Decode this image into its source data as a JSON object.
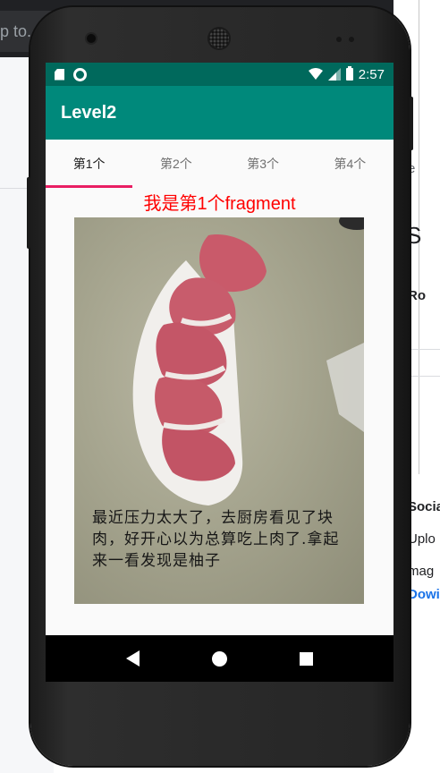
{
  "background": {
    "left_input_text": "p to.",
    "right_texts": [
      "e",
      "S",
      "Ro",
      "Socia",
      "Uplo",
      "mag",
      "Dowi"
    ]
  },
  "status_bar": {
    "time": "2:57",
    "icons": [
      "sd-card-icon",
      "sync-ring-icon",
      "wifi-icon",
      "signal-icon",
      "battery-icon"
    ]
  },
  "app_bar": {
    "title": "Level2"
  },
  "tabs": [
    {
      "label": "第1个",
      "active": true
    },
    {
      "label": "第2个",
      "active": false
    },
    {
      "label": "第3个",
      "active": false
    },
    {
      "label": "第4个",
      "active": false
    }
  ],
  "fragment": {
    "text": "我是第1个fragment",
    "photo_caption": "最近压力太大了，去厨房看见了块肉，好开心以为总算吃上肉了.拿起来一看发现是柚子"
  },
  "nav_bar": {
    "buttons": [
      "back",
      "home",
      "recents"
    ]
  },
  "colors": {
    "status_bar": "#00695c",
    "app_bar": "#00897b",
    "tab_indicator": "#e91e63",
    "fragment_text": "#ff0000"
  }
}
